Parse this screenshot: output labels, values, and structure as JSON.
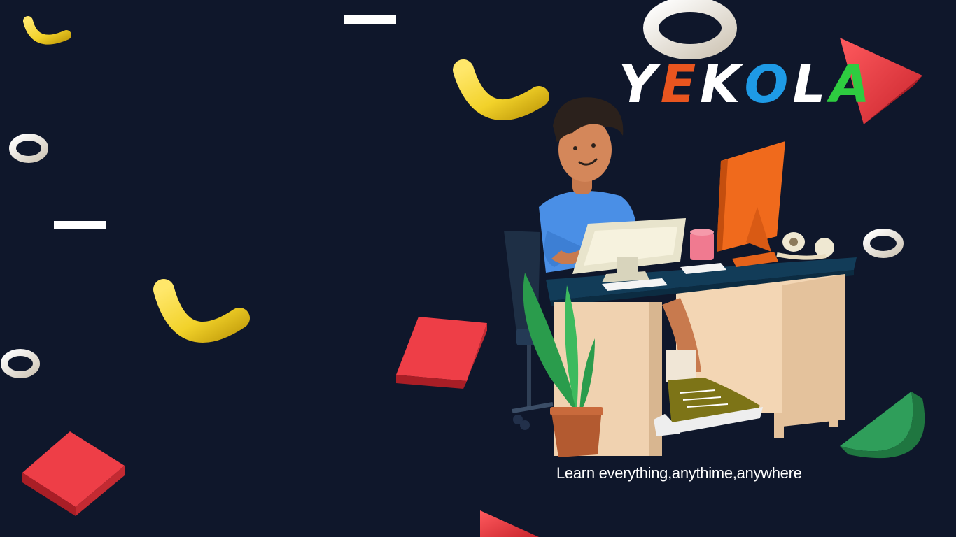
{
  "brand": {
    "letters": [
      {
        "char": "Y",
        "color": "#ffffff"
      },
      {
        "char": "E",
        "color": "#e8551f"
      },
      {
        "char": "K",
        "color": "#ffffff"
      },
      {
        "char": "O",
        "color": "#1e9ae6"
      },
      {
        "char": "L",
        "color": "#ffffff"
      },
      {
        "char": "A",
        "color": "#2ecc40"
      }
    ]
  },
  "tagline": "Learn everything,anythime,anywhere",
  "colors": {
    "background": "#0f172b",
    "yellow": "#f2d22a",
    "red": "#e83a42",
    "cream": "#e9e3d6",
    "green": "#2f9e5a",
    "orange": "#f06a1c",
    "desk_top": "#14405a",
    "desk_wood": "#f0d2b0",
    "shirt": "#4a8fe6"
  },
  "icons": [
    "hero-illustration",
    "torus-decoration",
    "tube-decoration",
    "cube-decoration",
    "cone-decoration",
    "half-disc-decoration",
    "dash-decoration"
  ]
}
